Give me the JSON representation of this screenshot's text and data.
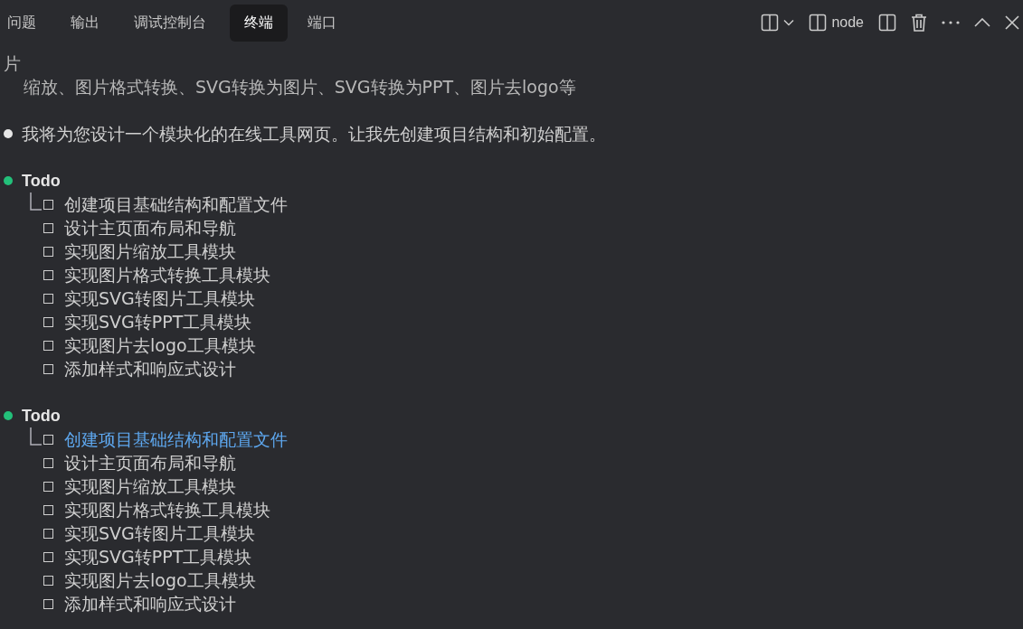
{
  "tabs": [
    {
      "label": "问题",
      "selected": false
    },
    {
      "label": "输出",
      "selected": false
    },
    {
      "label": "调试控制台",
      "selected": false
    },
    {
      "label": "终端",
      "selected": true
    },
    {
      "label": "端口",
      "selected": false
    }
  ],
  "toolbar": {
    "terminal_name": "node"
  },
  "terminal": [
    {
      "kind": "text",
      "text": "片",
      "indent": false
    },
    {
      "kind": "text",
      "text": "缩放、图片格式转换、SVG转换为图片、SVG转换为PPT、图片去logo等",
      "indent": true
    },
    {
      "kind": "blank"
    },
    {
      "kind": "bullet",
      "color": "#e6e6e6",
      "text": "我将为您设计一个模块化的在线工具网页。让我先创建项目结构和初始配置。"
    },
    {
      "kind": "blank"
    },
    {
      "kind": "todo",
      "color": "#23c07a",
      "title": "Todo",
      "items": [
        {
          "text": "创建项目基础结构和配置文件",
          "checked": false,
          "active": false
        },
        {
          "text": "设计主页面布局和导航",
          "checked": false,
          "active": false
        },
        {
          "text": "实现图片缩放工具模块",
          "checked": false,
          "active": false
        },
        {
          "text": "实现图片格式转换工具模块",
          "checked": false,
          "active": false
        },
        {
          "text": "实现SVG转图片工具模块",
          "checked": false,
          "active": false
        },
        {
          "text": "实现SVG转PPT工具模块",
          "checked": false,
          "active": false
        },
        {
          "text": "实现图片去logo工具模块",
          "checked": false,
          "active": false
        },
        {
          "text": "添加样式和响应式设计",
          "checked": false,
          "active": false
        }
      ]
    },
    {
      "kind": "blank"
    },
    {
      "kind": "todo",
      "color": "#23c07a",
      "title": "Todo",
      "items": [
        {
          "text": "创建项目基础结构和配置文件",
          "checked": false,
          "active": true
        },
        {
          "text": "设计主页面布局和导航",
          "checked": false,
          "active": false
        },
        {
          "text": "实现图片缩放工具模块",
          "checked": false,
          "active": false
        },
        {
          "text": "实现图片格式转换工具模块",
          "checked": false,
          "active": false
        },
        {
          "text": "实现SVG转图片工具模块",
          "checked": false,
          "active": false
        },
        {
          "text": "实现SVG转PPT工具模块",
          "checked": false,
          "active": false
        },
        {
          "text": "实现图片去logo工具模块",
          "checked": false,
          "active": false
        },
        {
          "text": "添加样式和响应式设计",
          "checked": false,
          "active": false
        }
      ]
    }
  ]
}
